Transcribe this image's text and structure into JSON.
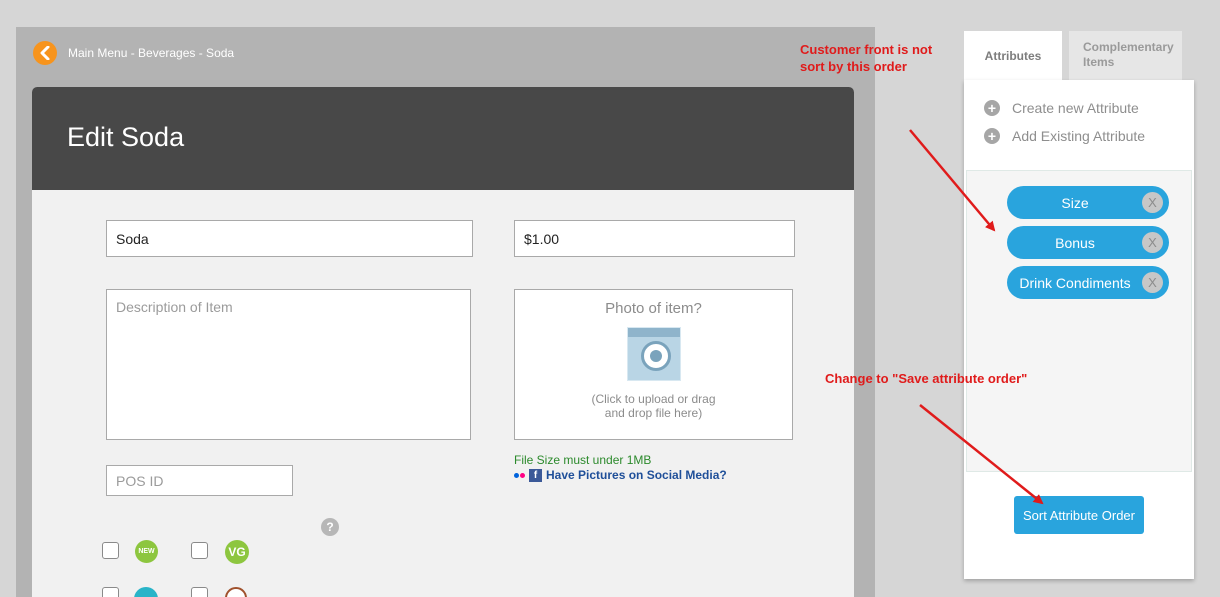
{
  "header": {
    "breadcrumb": "Main Menu - Beverages - Soda",
    "back_icon": "chevron-left-icon"
  },
  "edit_card": {
    "title": "Edit Soda",
    "name_value": "Soda",
    "price_value": "$1.00",
    "description_placeholder": "Description of Item",
    "photo": {
      "title": "Photo of item?",
      "hint_line1": "(Click to upload or drag",
      "hint_line2": "and drop file here)"
    },
    "file_size_note": "File Size must under 1MB",
    "social_link": "Have Pictures on Social Media?",
    "pos_placeholder": "POS ID",
    "help_label": "?",
    "badges": [
      {
        "label": "NEW",
        "color": "#8dc63f"
      },
      {
        "label": "VG",
        "color": "#8dc63f"
      }
    ]
  },
  "side_panel": {
    "tabs": [
      {
        "label": "Attributes",
        "active": true
      },
      {
        "label": "Complementary Items",
        "line1": "Complementary",
        "line2": "Items",
        "active": false
      }
    ],
    "actions": [
      {
        "label": "Create new Attribute",
        "icon": "plus-circle-icon"
      },
      {
        "label": "Add Existing Attribute",
        "icon": "plus-circle-icon"
      }
    ],
    "attributes": [
      {
        "label": "Size",
        "remove": "X"
      },
      {
        "label": "Bonus",
        "remove": "X"
      },
      {
        "label": "Drink Condiments",
        "remove": "X"
      }
    ],
    "sort_button": "Sort Attribute Order"
  },
  "annotations": {
    "note1_line1": "Customer front is not",
    "note1_line2": "sort by this order",
    "note2": "Change to \"Save attribute order\""
  },
  "colors": {
    "accent_blue": "#29a4dd",
    "back_orange": "#f7941d",
    "annotation_red": "#e01b1b",
    "header_dark": "#484848"
  }
}
